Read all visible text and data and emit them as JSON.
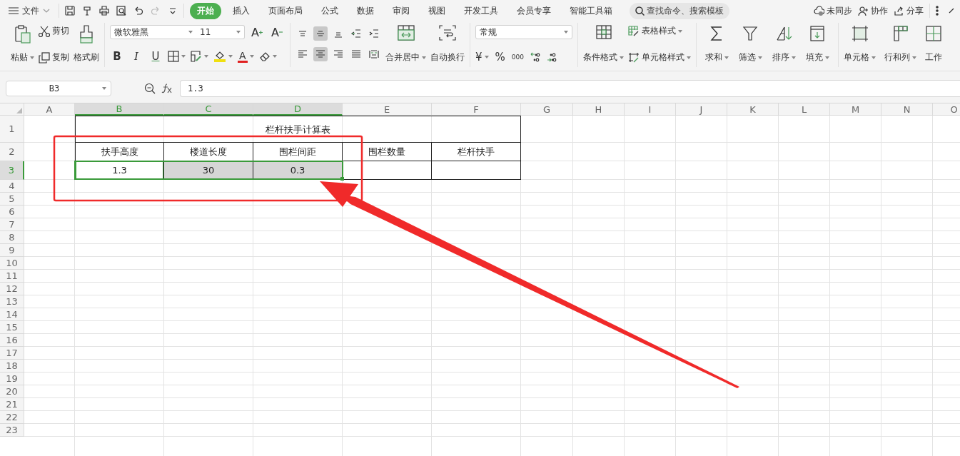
{
  "menu_bar": {
    "file_menu": "文件",
    "tabs": [
      {
        "label": "开始",
        "selected": true
      },
      {
        "label": "插入",
        "selected": false
      },
      {
        "label": "页面布局",
        "selected": false
      },
      {
        "label": "公式",
        "selected": false
      },
      {
        "label": "数据",
        "selected": false
      },
      {
        "label": "审阅",
        "selected": false
      },
      {
        "label": "视图",
        "selected": false
      },
      {
        "label": "开发工具",
        "selected": false
      },
      {
        "label": "会员专享",
        "selected": false
      },
      {
        "label": "智能工具箱",
        "selected": false
      }
    ],
    "search": {
      "placeholder": "查找命令、搜索模板"
    },
    "actions": [
      {
        "kind": "sync",
        "label": "未同步"
      },
      {
        "kind": "collab",
        "label": "协作"
      },
      {
        "kind": "share",
        "label": "分享"
      }
    ]
  },
  "ribbon": {
    "clipboard": {
      "paste": "粘贴",
      "cut": "剪切",
      "copy": "复制",
      "format_painter": "格式刷"
    },
    "font": {
      "name": "微软雅黑",
      "size": "11",
      "grow": "A",
      "shrink": "A",
      "styles": [
        {
          "kind": "bold",
          "label": "B"
        },
        {
          "kind": "italic",
          "label": "I"
        },
        {
          "kind": "underline",
          "label": "U"
        }
      ],
      "font_color": "A"
    },
    "alignment": {
      "buttons": [
        {
          "kind": "top",
          "selected": false
        },
        {
          "kind": "middle",
          "selected": true
        },
        {
          "kind": "bottom",
          "selected": false
        },
        {
          "kind": "outdent",
          "selected": false
        },
        {
          "kind": "indent",
          "selected": false
        },
        {
          "kind": "left",
          "selected": false
        },
        {
          "kind": "center",
          "selected": true
        },
        {
          "kind": "right",
          "selected": false
        },
        {
          "kind": "justify",
          "selected": false
        },
        {
          "kind": "distributed",
          "selected": false
        }
      ],
      "merge": "合并居中",
      "wrap": "自动换行"
    },
    "number": {
      "format": "常规",
      "currency": "¥",
      "percent": "%",
      "thousands": "000"
    },
    "styles": {
      "conditional": "条件格式",
      "table_style": "表格样式",
      "cell_style": "单元格样式"
    },
    "editing": [
      {
        "kind": "sum",
        "label": "求和"
      },
      {
        "kind": "filter",
        "label": "筛选"
      },
      {
        "kind": "sort",
        "label": "排序"
      },
      {
        "kind": "fill",
        "label": "填充"
      }
    ],
    "cells": [
      {
        "kind": "cell",
        "label": "单元格"
      },
      {
        "kind": "rowcol",
        "label": "行和列"
      },
      {
        "kind": "sheet",
        "label": "工作"
      }
    ]
  },
  "formula_bar": {
    "name_box": "B3",
    "value": "1.3"
  },
  "sheet": {
    "columns": [
      {
        "label": "A",
        "selected": false
      },
      {
        "label": "B",
        "selected": true
      },
      {
        "label": "C",
        "selected": true
      },
      {
        "label": "D",
        "selected": true
      },
      {
        "label": "E",
        "selected": false
      },
      {
        "label": "F",
        "selected": false
      },
      {
        "label": "G",
        "selected": false
      },
      {
        "label": "H",
        "selected": false
      },
      {
        "label": "I",
        "selected": false
      },
      {
        "label": "J",
        "selected": false
      },
      {
        "label": "K",
        "selected": false
      },
      {
        "label": "L",
        "selected": false
      },
      {
        "label": "M",
        "selected": false
      },
      {
        "label": "N",
        "selected": false
      },
      {
        "label": "O",
        "selected": false
      }
    ],
    "rows": [
      {
        "label": "1",
        "selected": false
      },
      {
        "label": "2",
        "selected": false
      },
      {
        "label": "3",
        "selected": true
      },
      {
        "label": "4",
        "selected": false
      },
      {
        "label": "5",
        "selected": false
      },
      {
        "label": "6",
        "selected": false
      },
      {
        "label": "7",
        "selected": false
      },
      {
        "label": "8",
        "selected": false
      },
      {
        "label": "9",
        "selected": false
      },
      {
        "label": "10",
        "selected": false
      },
      {
        "label": "11",
        "selected": false
      },
      {
        "label": "12",
        "selected": false
      },
      {
        "label": "13",
        "selected": false
      },
      {
        "label": "14",
        "selected": false
      },
      {
        "label": "15",
        "selected": false
      },
      {
        "label": "16",
        "selected": false
      },
      {
        "label": "17",
        "selected": false
      },
      {
        "label": "18",
        "selected": false
      },
      {
        "label": "19",
        "selected": false
      },
      {
        "label": "20",
        "selected": false
      },
      {
        "label": "21",
        "selected": false
      },
      {
        "label": "22",
        "selected": false
      },
      {
        "label": "23",
        "selected": false
      }
    ],
    "table": {
      "title": "栏杆扶手计算表",
      "headers": [
        "扶手高度",
        "楼道长度",
        "围栏间距",
        "围栏数量",
        "栏杆扶手"
      ],
      "values": [
        {
          "value": "1.3",
          "selected": true,
          "active": true
        },
        {
          "value": "30",
          "selected": true,
          "active": false
        },
        {
          "value": "0.3",
          "selected": true,
          "active": false
        },
        {
          "selected": false,
          "active": false
        },
        {
          "selected": false,
          "active": false
        }
      ]
    }
  }
}
